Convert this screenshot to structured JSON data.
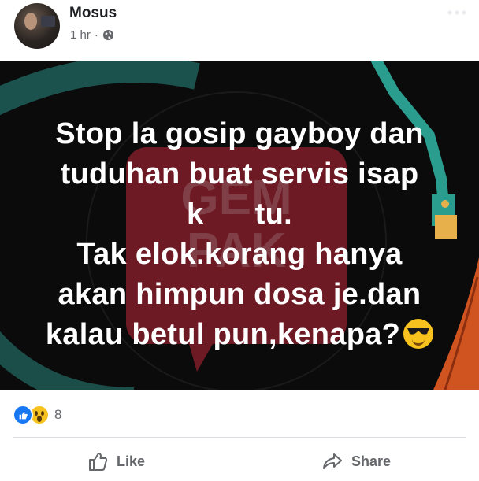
{
  "post": {
    "author": "Mosus",
    "time": "1 hr",
    "separator": "·",
    "privacy_icon": "globe-icon"
  },
  "image": {
    "lines": [
      "Stop la gosip gayboy dan",
      "tuduhan buat servis isap",
      "k      tu.",
      "Tak elok.korang hanya",
      "akan himpun dosa je.dan",
      "kalau betul pun,kenapa?"
    ],
    "emoji": "smiling-face-with-sunglasses",
    "watermark": "GEMPAK",
    "colors": {
      "background": "#0b0b0b",
      "accent_teal": "#2a9d8f",
      "accent_orange": "#d0541f",
      "watermark_red": "#c0283a"
    }
  },
  "reactions": {
    "icons": [
      "like-reaction-icon",
      "wow-reaction-icon"
    ],
    "count": "8"
  },
  "actions": {
    "like_label": "Like",
    "share_label": "Share"
  }
}
